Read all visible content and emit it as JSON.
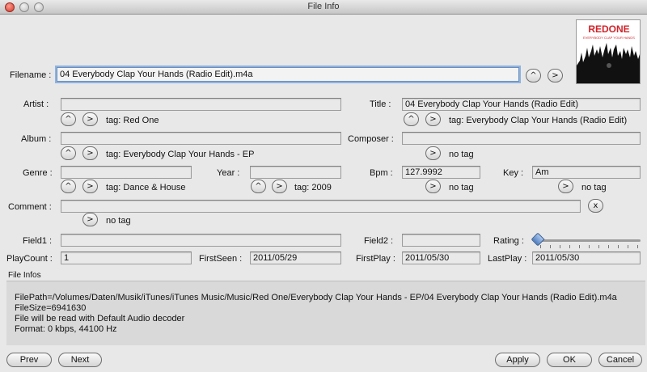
{
  "window": {
    "title": "File Info"
  },
  "labels": {
    "filename": "Filename :",
    "artist": "Artist :",
    "title": "Title :",
    "album": "Album :",
    "composer": "Composer :",
    "genre": "Genre :",
    "year": "Year :",
    "bpm": "Bpm :",
    "key": "Key :",
    "comment": "Comment :",
    "field1": "Field1 :",
    "field2": "Field2 :",
    "rating": "Rating :",
    "playcount": "PlayCount :",
    "firstseen": "FirstSeen :",
    "firstplay": "FirstPlay :",
    "lastplay": "LastPlay :"
  },
  "values": {
    "filename": "04 Everybody Clap Your Hands (Radio Edit).m4a",
    "artist": "",
    "title": "04 Everybody Clap Your Hands (Radio Edit)",
    "album": "",
    "composer": "",
    "genre": "",
    "year": "",
    "bpm": "127.9992",
    "key": "Am",
    "comment": "",
    "field1": "",
    "field2": "",
    "playcount": "1",
    "firstseen": "2011/05/29",
    "firstplay": "2011/05/30",
    "lastplay": "2011/05/30"
  },
  "tags": {
    "artist": "tag: Red One",
    "title": "tag: Everybody Clap Your Hands (Radio Edit)",
    "album": "tag: Everybody Clap Your Hands - EP",
    "composer": "no tag",
    "genre": "tag: Dance & House",
    "year": "tag: 2009",
    "bpm": "no tag",
    "key": "no tag",
    "comment": "no tag"
  },
  "glyphs": {
    "up": "^",
    "right": ">",
    "clear": "x"
  },
  "rating": {
    "value": 0
  },
  "album_art": {
    "text": "REDONE",
    "subtext": "EVERYBODY CLAP YOUR HANDS",
    "accent": "#d2232a"
  },
  "file_infos": {
    "heading": "File Infos",
    "lines": [
      "FilePath=/Volumes/Daten/Musik/iTunes/iTunes Music/Music/Red One/Everybody Clap Your Hands - EP/04 Everybody Clap Your Hands (Radio Edit).m4a",
      "FileSize=6941630",
      "File will be read with Default Audio decoder",
      "Format: 0 kbps, 44100 Hz"
    ]
  },
  "buttons": {
    "prev": "Prev",
    "next": "Next",
    "apply": "Apply",
    "ok": "OK",
    "cancel": "Cancel"
  }
}
